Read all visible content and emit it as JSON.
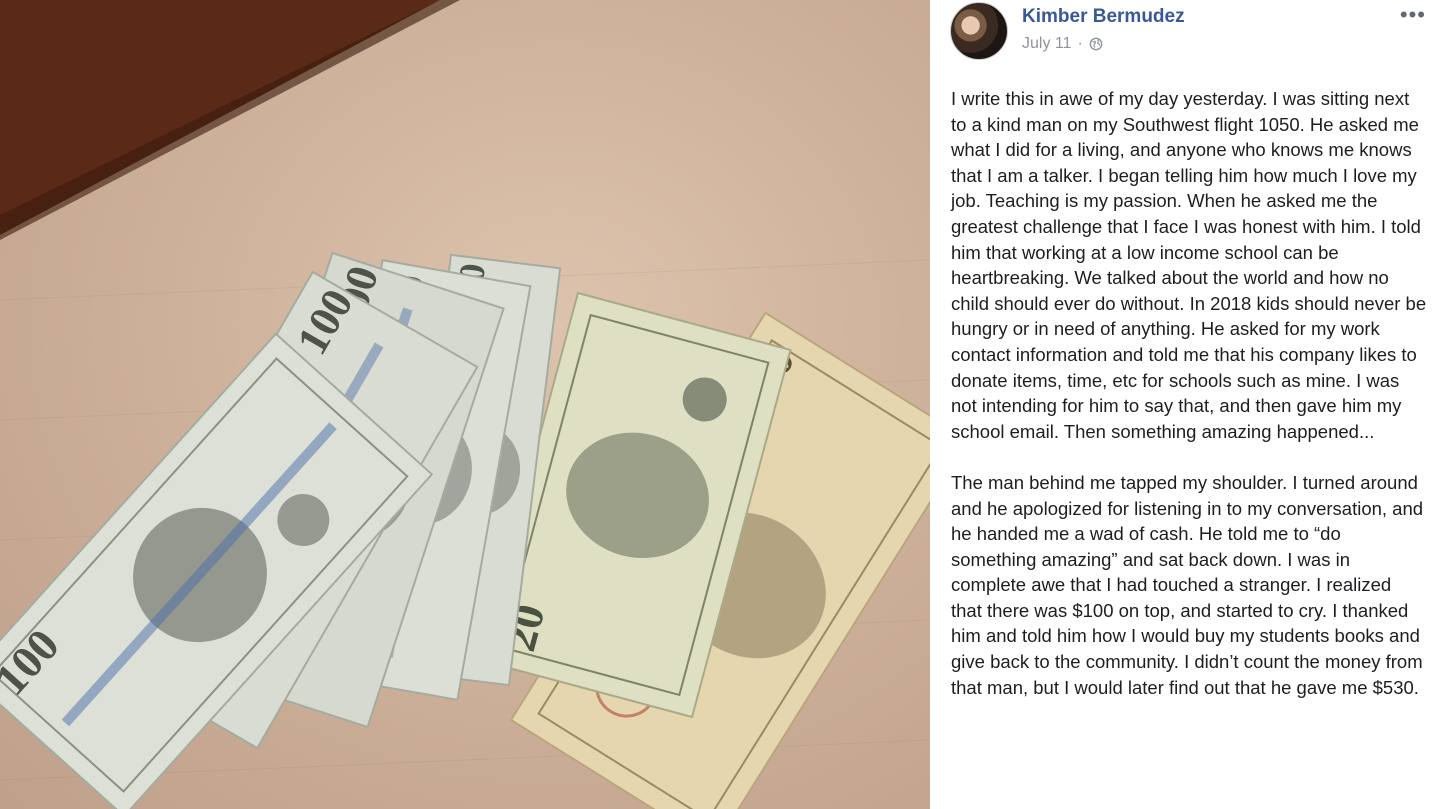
{
  "post": {
    "author": "Kimber Bermudez",
    "date": "July 11",
    "separator": "·",
    "privacy_icon": "globe-icon",
    "more_icon": "more-horizontal-icon",
    "more_label": "•••",
    "paragraphs": [
      "I write this in awe of my day yesterday. I was sitting next to a kind man on my Southwest flight 1050. He asked me what I did for a living, and anyone who knows me knows that I am a talker. I began telling him how much I love my job. Teaching is my passion. When he asked me the greatest challenge that I face I was honest with him. I told him that working at a low income school can be heartbreaking. We talked about the world and how no child should ever do without. In 2018 kids should never be hungry or in need of anything. He asked for my work contact information and told me that his company likes to donate items, time, etc for schools such as mine. I was not intending for him to say that, and then gave him my school email. Then something amazing happened...",
      "The man behind me tapped my shoulder. I turned around and he apologized for listening in to my conversation, and he handed me a wad of cash. He told me to “do something amazing” and sat back down. I was in complete awe that I had touched a stranger. I realized that there was $100 on top, and started to cry. I thanked him and told him how I would buy my students books and give back to the community. I didn’t count the money from that man, but I would later find out that he gave me $530."
    ]
  },
  "photo": {
    "description_icon": "cash-photo",
    "bill_labels": [
      "100",
      "100",
      "100",
      "100",
      "100",
      "20",
      "10"
    ]
  },
  "colors": {
    "link": "#385898",
    "meta": "#90949c",
    "text": "#1c1e21",
    "carpet": "#cfb29c",
    "wood": "#5a2a17"
  }
}
